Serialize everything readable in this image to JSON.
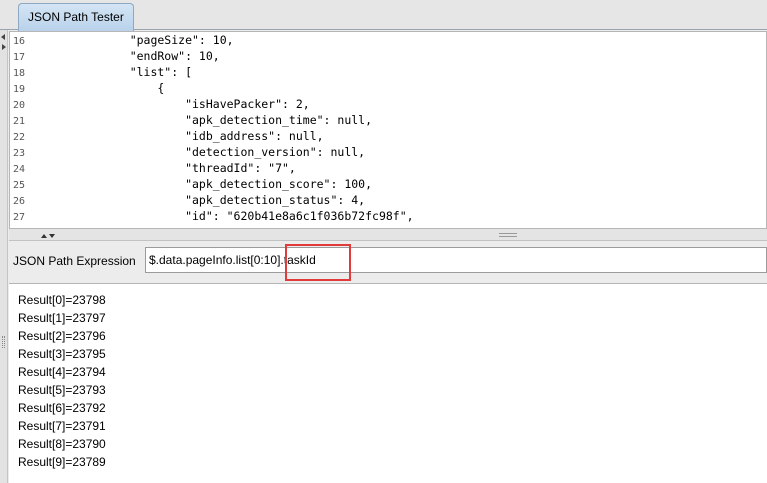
{
  "tabs": [
    {
      "label": "JSON Path Tester"
    }
  ],
  "editor": {
    "lines": [
      {
        "num": "16",
        "text": "    \"pageSize\": 10,"
      },
      {
        "num": "17",
        "text": "    \"endRow\": 10,"
      },
      {
        "num": "18",
        "text": "    \"list\": ["
      },
      {
        "num": "19",
        "text": "        {"
      },
      {
        "num": "20",
        "text": "            \"isHavePacker\": 2,"
      },
      {
        "num": "21",
        "text": "            \"apk_detection_time\": null,"
      },
      {
        "num": "22",
        "text": "            \"idb_address\": null,"
      },
      {
        "num": "23",
        "text": "            \"detection_version\": null,"
      },
      {
        "num": "24",
        "text": "            \"threadId\": \"7\","
      },
      {
        "num": "25",
        "text": "            \"apk_detection_score\": 100,"
      },
      {
        "num": "26",
        "text": "            \"apk_detection_status\": 4,"
      },
      {
        "num": "27",
        "text": "            \"id\": \"620b41e8a6c1f036b72fc98f\","
      }
    ]
  },
  "expression": {
    "label": "JSON Path Expression",
    "value": "$.data.pageInfo.list[0:10].taskId"
  },
  "results": [
    "Result[0]=23798",
    "Result[1]=23797",
    "Result[2]=23796",
    "Result[3]=23795",
    "Result[4]=23794",
    "Result[5]=23793",
    "Result[6]=23792",
    "Result[7]=23791",
    "Result[8]=23790",
    "Result[9]=23789"
  ],
  "colors": {
    "highlight": "#e23b3b",
    "tab_active": "#c6dcf0"
  }
}
